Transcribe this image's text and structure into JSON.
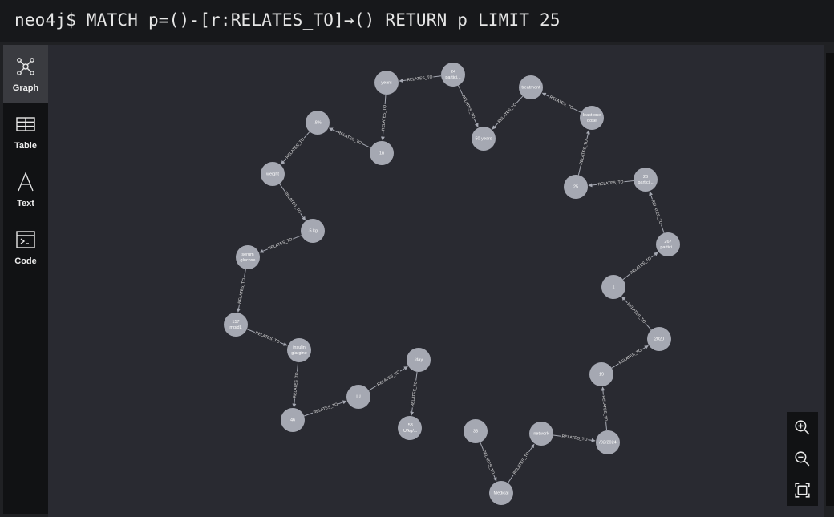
{
  "query": {
    "prompt": "neo4j$",
    "text": "MATCH p=()-[r:RELATES_TO]→() RETURN p LIMIT 25"
  },
  "sidebar": {
    "items": [
      {
        "label": "Graph",
        "icon": "graph-icon",
        "active": true
      },
      {
        "label": "Table",
        "icon": "table-icon"
      },
      {
        "label": "Text",
        "icon": "text-icon"
      },
      {
        "label": "Code",
        "icon": "code-icon"
      }
    ]
  },
  "graph": {
    "node_color": "#a5a8b2",
    "relationship_label": "RELATES_TO",
    "nodes": [
      {
        "id": "years",
        "lines": [
          "years"
        ]
      },
      {
        "id": "24p",
        "lines": [
          "24",
          "partici..."
        ]
      },
      {
        "id": "treatment",
        "lines": [
          "treatment"
        ]
      },
      {
        "id": "50years",
        "lines": [
          "50 years"
        ]
      },
      {
        "id": "leastone",
        "lines": [
          "least one",
          "dose"
        ]
      },
      {
        "id": "pct",
        "lines": [
          ".8%"
        ]
      },
      {
        "id": "1n",
        "lines": [
          "1n"
        ]
      },
      {
        "id": "n25",
        "lines": [
          "25"
        ]
      },
      {
        "id": "26p",
        "lines": [
          "26",
          "partici..."
        ]
      },
      {
        "id": "weight",
        "lines": [
          "weight"
        ]
      },
      {
        "id": "5kg",
        "lines": [
          ".5 kg"
        ]
      },
      {
        "id": "267p",
        "lines": [
          "267",
          "partici..."
        ]
      },
      {
        "id": "serum",
        "lines": [
          "serum",
          "glucose"
        ]
      },
      {
        "id": "n1",
        "lines": [
          "1"
        ]
      },
      {
        "id": "157",
        "lines": [
          "157",
          "mg/dL"
        ]
      },
      {
        "id": "y2020",
        "lines": [
          "2020"
        ]
      },
      {
        "id": "insulin",
        "lines": [
          "insulin",
          "glargine"
        ]
      },
      {
        "id": "day",
        "lines": [
          "/day"
        ]
      },
      {
        "id": "n19",
        "lines": [
          "19"
        ]
      },
      {
        "id": "iu",
        "lines": [
          "IU"
        ]
      },
      {
        "id": "n46",
        "lines": [
          "46"
        ]
      },
      {
        "id": "iukg",
        "lines": [
          ".53",
          "IU/kg/..."
        ]
      },
      {
        "id": "n33",
        "lines": [
          "33"
        ]
      },
      {
        "id": "network",
        "lines": [
          "network"
        ]
      },
      {
        "id": "date",
        "lines": [
          "/02/2024"
        ]
      },
      {
        "id": "medical",
        "lines": [
          "Medical"
        ]
      }
    ],
    "relationships": [
      {
        "from": "24p",
        "to": "years"
      },
      {
        "from": "years",
        "to": "1n"
      },
      {
        "from": "1n",
        "to": "pct"
      },
      {
        "from": "pct",
        "to": "weight"
      },
      {
        "from": "weight",
        "to": "5kg"
      },
      {
        "from": "5kg",
        "to": "serum"
      },
      {
        "from": "serum",
        "to": "157"
      },
      {
        "from": "157",
        "to": "insulin"
      },
      {
        "from": "insulin",
        "to": "n46"
      },
      {
        "from": "n46",
        "to": "iu"
      },
      {
        "from": "iu",
        "to": "day"
      },
      {
        "from": "day",
        "to": "iukg"
      },
      {
        "from": "24p",
        "to": "50years"
      },
      {
        "from": "treatment",
        "to": "50years"
      },
      {
        "from": "leastone",
        "to": "treatment"
      },
      {
        "from": "n25",
        "to": "leastone"
      },
      {
        "from": "26p",
        "to": "n25"
      },
      {
        "from": "267p",
        "to": "26p"
      },
      {
        "from": "n1",
        "to": "267p"
      },
      {
        "from": "y2020",
        "to": "n1"
      },
      {
        "from": "n19",
        "to": "y2020"
      },
      {
        "from": "date",
        "to": "n19"
      },
      {
        "from": "network",
        "to": "date"
      },
      {
        "from": "medical",
        "to": "network"
      },
      {
        "from": "n33",
        "to": "medical"
      }
    ]
  },
  "zoom_controls": [
    {
      "name": "zoom-in-button",
      "icon": "zoom-in-icon"
    },
    {
      "name": "zoom-out-button",
      "icon": "zoom-out-icon"
    },
    {
      "name": "fit-to-screen-button",
      "icon": "fit-screen-icon"
    }
  ]
}
